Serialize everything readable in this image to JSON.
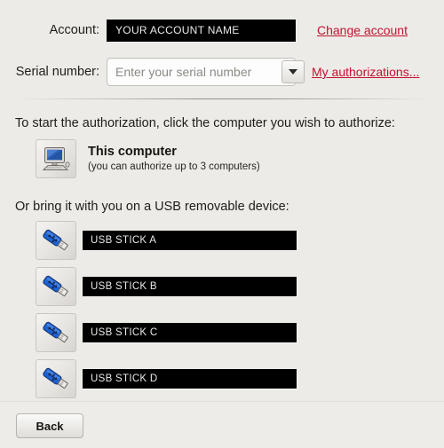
{
  "form": {
    "account": {
      "label": "Account:",
      "value": "YOUR ACCOUNT NAME",
      "link": "Change account"
    },
    "serial": {
      "label": "Serial number:",
      "value": "",
      "placeholder": "Enter your serial number",
      "link": "My authorizations..."
    }
  },
  "prompts": {
    "authorize": "To start the authorization, click the computer you wish to authorize:",
    "usb": "Or bring it with you on a USB removable device:"
  },
  "computer": {
    "title": "This computer",
    "subtitle": "(you can authorize up to 3 computers)"
  },
  "usb_devices": [
    {
      "name": "USB STICK A"
    },
    {
      "name": "USB STICK B"
    },
    {
      "name": "USB STICK C"
    },
    {
      "name": "USB STICK D"
    }
  ],
  "footer": {
    "back": "Back"
  },
  "colors": {
    "background": "#edebe7",
    "link": "#c41230",
    "redacted": "#000000",
    "usb_body": "#1b63d4"
  }
}
